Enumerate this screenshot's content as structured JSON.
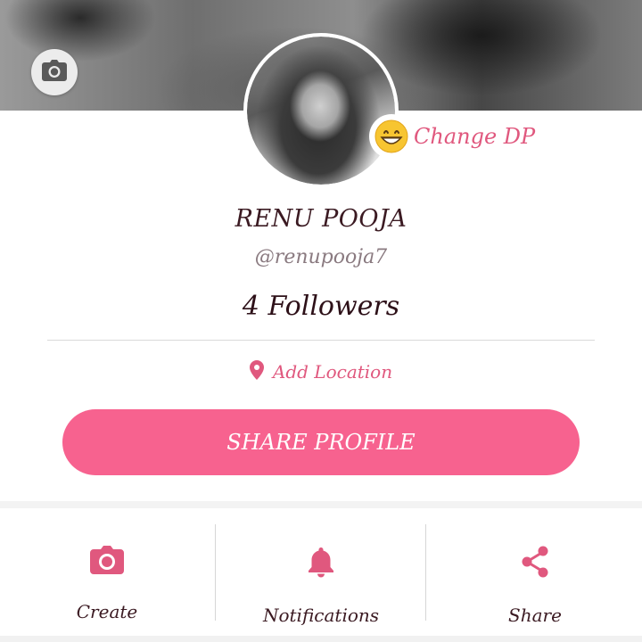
{
  "profile": {
    "name": "RENU POOJA",
    "handle": "@renupooja7",
    "followers": "4 Followers",
    "change_dp_label": "Change DP",
    "change_dp_emoji": "😁",
    "add_location_label": "Add Location",
    "share_profile_label": "SHARE PROFILE"
  },
  "cover": {
    "camera_icon": "camera-icon"
  },
  "bottom_nav": {
    "items": [
      {
        "label": "Create",
        "icon": "camera-icon"
      },
      {
        "label": "Notifications",
        "icon": "bell-icon"
      },
      {
        "label": "Share",
        "icon": "share-icon"
      }
    ]
  },
  "colors": {
    "accent": "#f7628f",
    "accent_text": "#e0587e",
    "dark_text": "#3b1a22"
  }
}
